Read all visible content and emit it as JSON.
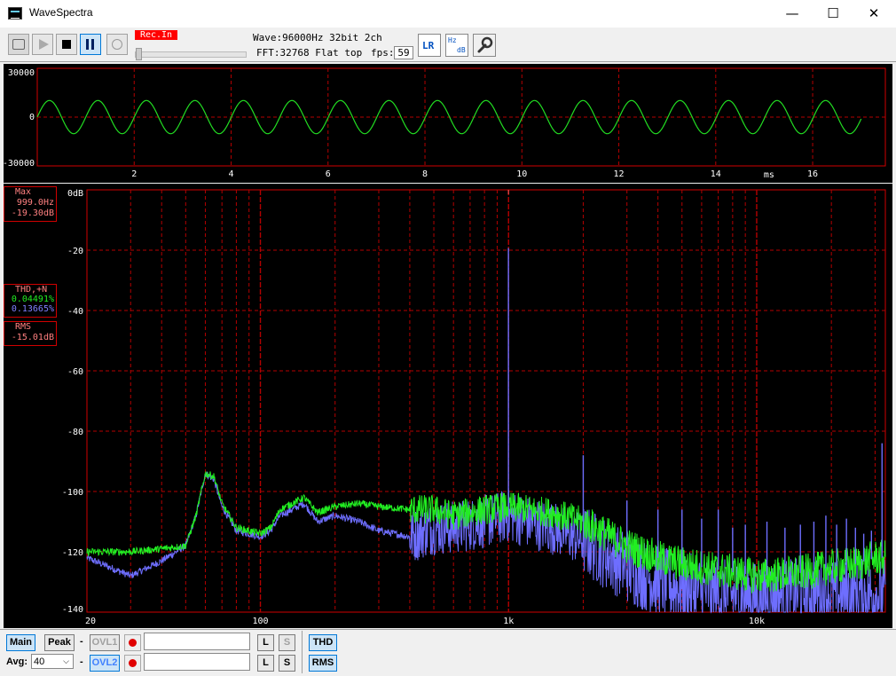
{
  "window": {
    "title": "WaveSpectra",
    "minimize": "—",
    "maximize": "☐",
    "close": "✕"
  },
  "toolbar": {
    "rec_badge": "Rec.In",
    "wave_label": "Wave:",
    "wave_value": "96000Hz 32bit 2ch",
    "fft_label": "FFT:",
    "fft_value": "32768 Flat top",
    "fps_label": "fps:",
    "fps_value": "59",
    "lr_icon": "LR",
    "hz_icon_top": "Hz",
    "hz_icon_bottom": "dB"
  },
  "wave_panel": {
    "y_labels": [
      "30000",
      "0",
      "-30000"
    ],
    "x_labels": [
      "2",
      "4",
      "6",
      "8",
      "10",
      "12",
      "14",
      "16"
    ],
    "x_unit": "ms",
    "colors": {
      "line": "#22dd22",
      "grid": "#b40000",
      "frame": "#d00000"
    }
  },
  "spectrum_panel": {
    "y_labels": [
      "0dB",
      "-20",
      "-40",
      "-60",
      "-80",
      "-100",
      "-120",
      "-140"
    ],
    "x_labels": [
      "20",
      "100",
      "1k",
      "10k"
    ],
    "colors": {
      "left": "#6e6eff",
      "right": "#22ee22",
      "grid": "#b40000",
      "frame": "#d00000",
      "label": "#ff7777"
    }
  },
  "readouts": {
    "max_title": "Max",
    "max_freq": "999.0Hz",
    "max_level": "-19.30dB",
    "thd_title": "THD,+N",
    "thd_value": "0.04491%",
    "thdn_value": "0.13665%",
    "rms_title": "RMS",
    "rms_value": "-15.01dB"
  },
  "chart_data": [
    {
      "type": "line",
      "title": "",
      "xlabel": "ms",
      "ylabel": "",
      "xlim": [
        0,
        17.5
      ],
      "ylim": [
        -30000,
        30000
      ],
      "x_ticks": [
        2,
        4,
        6,
        8,
        10,
        12,
        14,
        16
      ],
      "y_ticks": [
        30000,
        0,
        -30000
      ],
      "series": [
        {
          "frequency_hz": 999,
          "amplitude": 10200,
          "x_start": 0,
          "x_end": 17.0
        }
      ],
      "grid": true
    },
    {
      "type": "line",
      "title": "",
      "xlabel": "",
      "ylabel": "",
      "x_scale": "log",
      "xlim": [
        20,
        33000
      ],
      "ylim": [
        -140,
        0
      ],
      "x_ticks": [
        20,
        100,
        1000,
        10000
      ],
      "y_ticks": [
        0,
        -20,
        -40,
        -60,
        -80,
        -100,
        -120,
        -140
      ],
      "grid": true,
      "series": [
        {
          "x": [
            20,
            30,
            40,
            50,
            55,
            60,
            65,
            70,
            80,
            90,
            100,
            110,
            120,
            150,
            170,
            200,
            250,
            300,
            400,
            500,
            600,
            800,
            1000,
            1200,
            1500,
            2000,
            3000,
            4000,
            5000,
            7000,
            10000,
            15000,
            20000,
            25000,
            30000,
            33000
          ],
          "y": [
            -120,
            -120,
            -119,
            -118,
            -108,
            -94,
            -95,
            -104,
            -112,
            -113,
            -114,
            -112,
            -106,
            -102,
            -107,
            -105,
            -104,
            -105,
            -106,
            -106,
            -108,
            -106,
            -105,
            -106,
            -107,
            -110,
            -118,
            -122,
            -124,
            -126,
            -128,
            -127,
            -125,
            -124,
            -122,
            -122
          ]
        },
        {
          "x": [
            20,
            30,
            40,
            50,
            55,
            60,
            65,
            70,
            80,
            90,
            100,
            110,
            120,
            150,
            170,
            200,
            250,
            300,
            400,
            500,
            600,
            800,
            1000,
            1200,
            1500,
            2000,
            3000,
            4000,
            5000,
            7000,
            10000,
            15000,
            20000,
            25000,
            30000,
            33000
          ],
          "y": [
            -122,
            -128,
            -123,
            -118,
            -108,
            -94,
            -96,
            -105,
            -113,
            -114,
            -115,
            -113,
            -108,
            -104,
            -110,
            -108,
            -110,
            -113,
            -115,
            -112,
            -112,
            -110,
            -108,
            -110,
            -112,
            -116,
            -125,
            -130,
            -132,
            -134,
            -135,
            -134,
            -134,
            -134,
            -134,
            -134
          ]
        }
      ],
      "peaks": [
        {
          "x": 999,
          "y": -19.3
        },
        {
          "x": 2000,
          "y": -88
        },
        {
          "x": 3000,
          "y": -103
        },
        {
          "x": 4000,
          "y": -106
        },
        {
          "x": 5000,
          "y": -106
        },
        {
          "x": 6000,
          "y": -109
        },
        {
          "x": 7000,
          "y": -106
        },
        {
          "x": 8000,
          "y": -112
        },
        {
          "x": 9000,
          "y": -111
        },
        {
          "x": 11000,
          "y": -110
        },
        {
          "x": 13000,
          "y": -112
        },
        {
          "x": 15000,
          "y": -111
        },
        {
          "x": 17000,
          "y": -110
        },
        {
          "x": 19000,
          "y": -108
        },
        {
          "x": 21000,
          "y": -111
        },
        {
          "x": 23000,
          "y": -109
        },
        {
          "x": 25000,
          "y": -112
        },
        {
          "x": 27000,
          "y": -114
        },
        {
          "x": 29000,
          "y": -113
        },
        {
          "x": 32000,
          "y": -84
        }
      ]
    }
  ],
  "bottom": {
    "main": "Main",
    "peak": "Peak",
    "dash1": "-",
    "ovl1": "OVL1",
    "dash2": "-",
    "ovl2": "OVL2",
    "avg_label": "Avg:",
    "avg_value": "40",
    "l1": "L",
    "s1": "S",
    "l2": "L",
    "s2": "S",
    "thd": "THD",
    "rms": "RMS"
  }
}
